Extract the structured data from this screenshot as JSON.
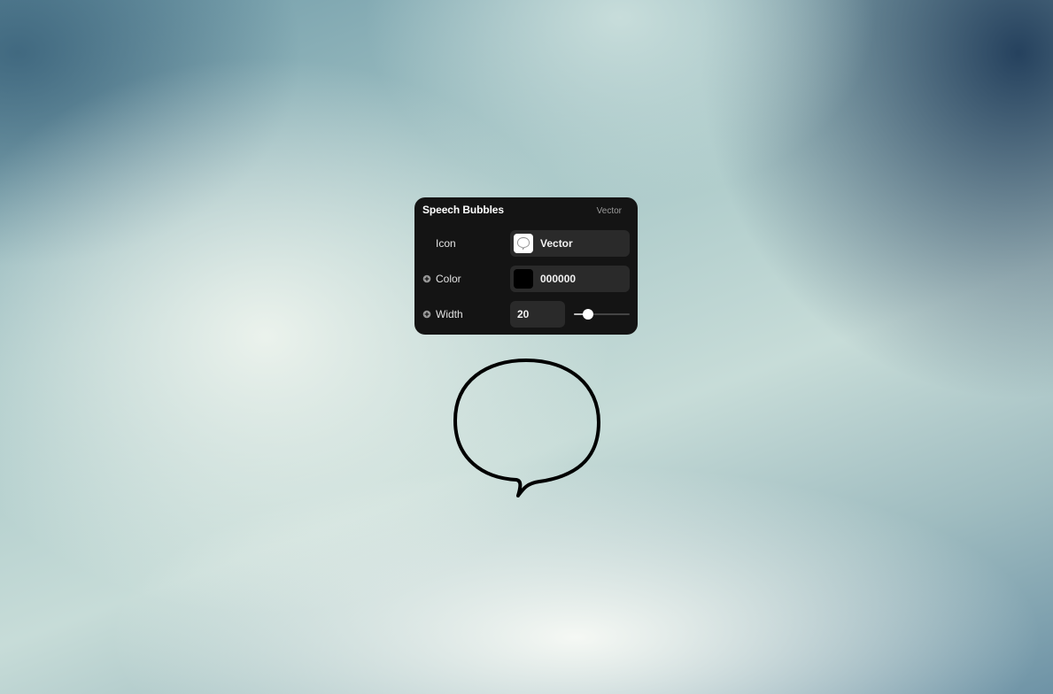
{
  "panel": {
    "title": "Speech Bubbles",
    "subtitle": "Vector",
    "rows": {
      "icon": {
        "label": "Icon",
        "value": "Vector",
        "icon_name": "speech-bubble-icon"
      },
      "color": {
        "label": "Color",
        "value": "000000",
        "swatch_color": "#000000"
      },
      "width": {
        "label": "Width",
        "value": "20",
        "slider_level": 0.25
      }
    }
  },
  "canvas": {
    "shape": "speech-bubble",
    "stroke_color": "#000000"
  },
  "colors": {
    "panel_background": "#141414",
    "field_background": "#2a2a2a"
  }
}
